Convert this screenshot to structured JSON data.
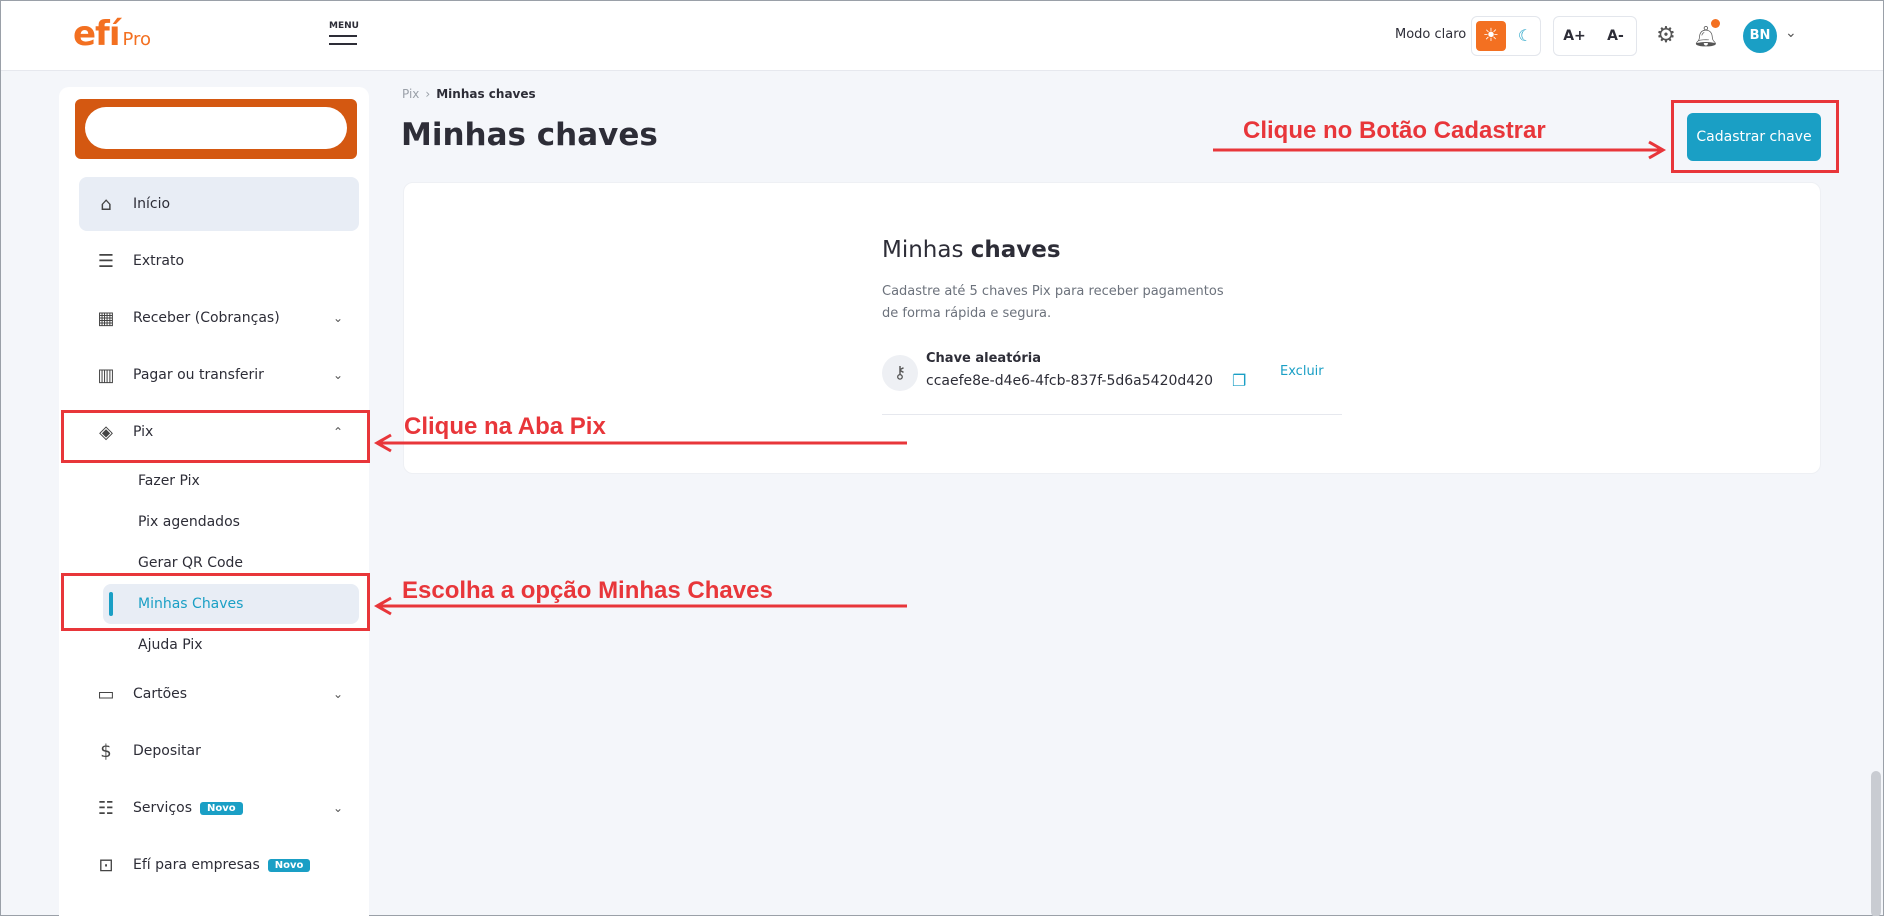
{
  "header": {
    "logo_main": "efí",
    "logo_sub": "Pro",
    "menu_label": "MENU",
    "mode_label": "Modo claro",
    "font_increase": "A+",
    "font_decrease": "A-",
    "avatar_initials": "BN",
    "accent_color": "#f37021",
    "primary_color": "#1a9fc5"
  },
  "sidebar": {
    "items": [
      {
        "label": "Início",
        "icon": "home-icon"
      },
      {
        "label": "Extrato",
        "icon": "receipt-icon"
      },
      {
        "label": "Receber (Cobranças)",
        "icon": "invoice-icon"
      },
      {
        "label": "Pagar ou transferir",
        "icon": "barcode-icon"
      },
      {
        "label": "Pix",
        "icon": "pix-icon"
      },
      {
        "label": "Cartões",
        "icon": "card-icon"
      },
      {
        "label": "Depositar",
        "icon": "deposit-icon"
      },
      {
        "label": "Serviços",
        "icon": "services-icon",
        "badge": "Novo"
      },
      {
        "label": "Efí para empresas",
        "icon": "briefcase-icon",
        "badge": "Novo"
      }
    ],
    "pix_sub": [
      {
        "label": "Fazer Pix"
      },
      {
        "label": "Pix agendados"
      },
      {
        "label": "Gerar QR Code"
      },
      {
        "label": "Minhas Chaves"
      },
      {
        "label": "Ajuda Pix"
      }
    ]
  },
  "main": {
    "breadcrumb_root": "Pix",
    "breadcrumb_current": "Minhas chaves",
    "title": "Minhas chaves",
    "register_button": "Cadastrar chave",
    "card": {
      "title_light": "Minhas ",
      "title_bold": "chaves",
      "description": "Cadastre até 5 chaves Pix para receber pagamentos de forma rápida e segura.",
      "key_type": "Chave aleatória",
      "key_value": "ccaefe8e-d4e6-4fcb-837f-5d6a5420d420",
      "delete_label": "Excluir"
    }
  },
  "annotations": {
    "register": "Clique no Botão Cadastrar",
    "pix_tab": "Clique na Aba Pix",
    "my_keys": "Escolha a opção Minhas Chaves",
    "color": "#e8363a"
  }
}
